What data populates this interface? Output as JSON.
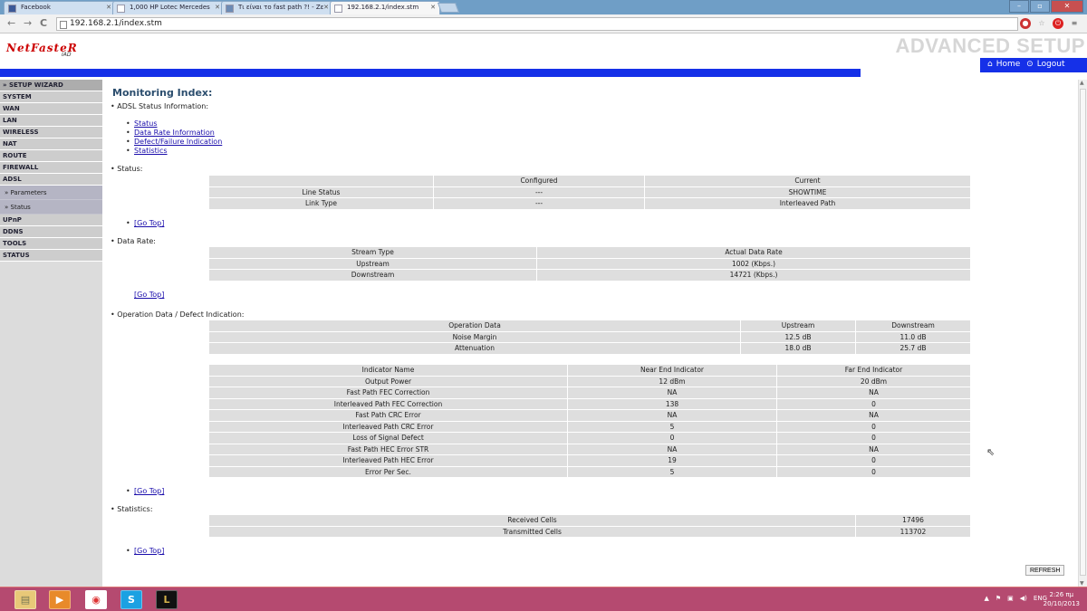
{
  "browser": {
    "tabs": [
      "Facebook",
      "1,000 HP Lotec Mercedes",
      "Τι είναι το fast path ?! - Ζε",
      "192.168.2.1/index.stm"
    ],
    "url": "192.168.2.1/index.stm"
  },
  "header": {
    "logo": "NetFasteR",
    "logo_sub": "IAD",
    "title": "ADVANCED SETUP",
    "home": "Home",
    "logout": "Logout"
  },
  "sidebar": {
    "items": [
      "» SETUP WIZARD",
      "SYSTEM",
      "WAN",
      "LAN",
      "WIRELESS",
      "NAT",
      "ROUTE",
      "FIREWALL",
      "ADSL",
      "» Parameters",
      "» Status",
      "UPnP",
      "DDNS",
      "TOOLS",
      "STATUS"
    ]
  },
  "main": {
    "title": "Monitoring Index:",
    "adsl_info_label": "ADSL Status Information:",
    "links": [
      "Status",
      "Data Rate Information",
      "Defect/Failure Indication",
      "Statistics"
    ],
    "go_top": "[Go Top]",
    "refresh": "REFRESH",
    "status": {
      "label": "Status:",
      "headers": [
        "",
        "Configured",
        "Current"
      ],
      "rows": [
        [
          "Line Status",
          "---",
          "SHOWTIME"
        ],
        [
          "Link Type",
          "---",
          "Interleaved Path"
        ]
      ]
    },
    "data_rate": {
      "label": "Data Rate:",
      "headers": [
        "Stream Type",
        "Actual Data Rate"
      ],
      "rows": [
        [
          "Upstream",
          "1002 (Kbps.)"
        ],
        [
          "Downstream",
          "14721 (Kbps.)"
        ]
      ]
    },
    "operation": {
      "label": "Operation Data / Defect Indication:",
      "headers": [
        "Operation Data",
        "Upstream",
        "Downstream"
      ],
      "rows": [
        [
          "Noise Margin",
          "12.5 dB",
          "11.0 dB"
        ],
        [
          "Attenuation",
          "18.0 dB",
          "25.7 dB"
        ]
      ]
    },
    "indicator": {
      "headers": [
        "Indicator Name",
        "Near End Indicator",
        "Far End Indicator"
      ],
      "rows": [
        [
          "Output Power",
          "12 dBm",
          "20 dBm"
        ],
        [
          "Fast Path FEC Correction",
          "NA",
          "NA"
        ],
        [
          "Interleaved Path FEC Correction",
          "138",
          "0"
        ],
        [
          "Fast Path CRC Error",
          "NA",
          "NA"
        ],
        [
          "Interleaved Path CRC Error",
          "5",
          "0"
        ],
        [
          "Loss of Signal Defect",
          "0",
          "0"
        ],
        [
          "Fast Path HEC Error STR",
          "NA",
          "NA"
        ],
        [
          "Interleaved Path HEC Error",
          "19",
          "0"
        ],
        [
          "Error Per Sec.",
          "5",
          "0"
        ]
      ]
    },
    "statistics": {
      "label": "Statistics:",
      "rows": [
        [
          "Received Cells",
          "17496"
        ],
        [
          "Transmitted Cells",
          "113702"
        ]
      ]
    }
  },
  "taskbar": {
    "lang": "ENG",
    "time": "2:26 πμ",
    "date": "20/10/2013"
  }
}
